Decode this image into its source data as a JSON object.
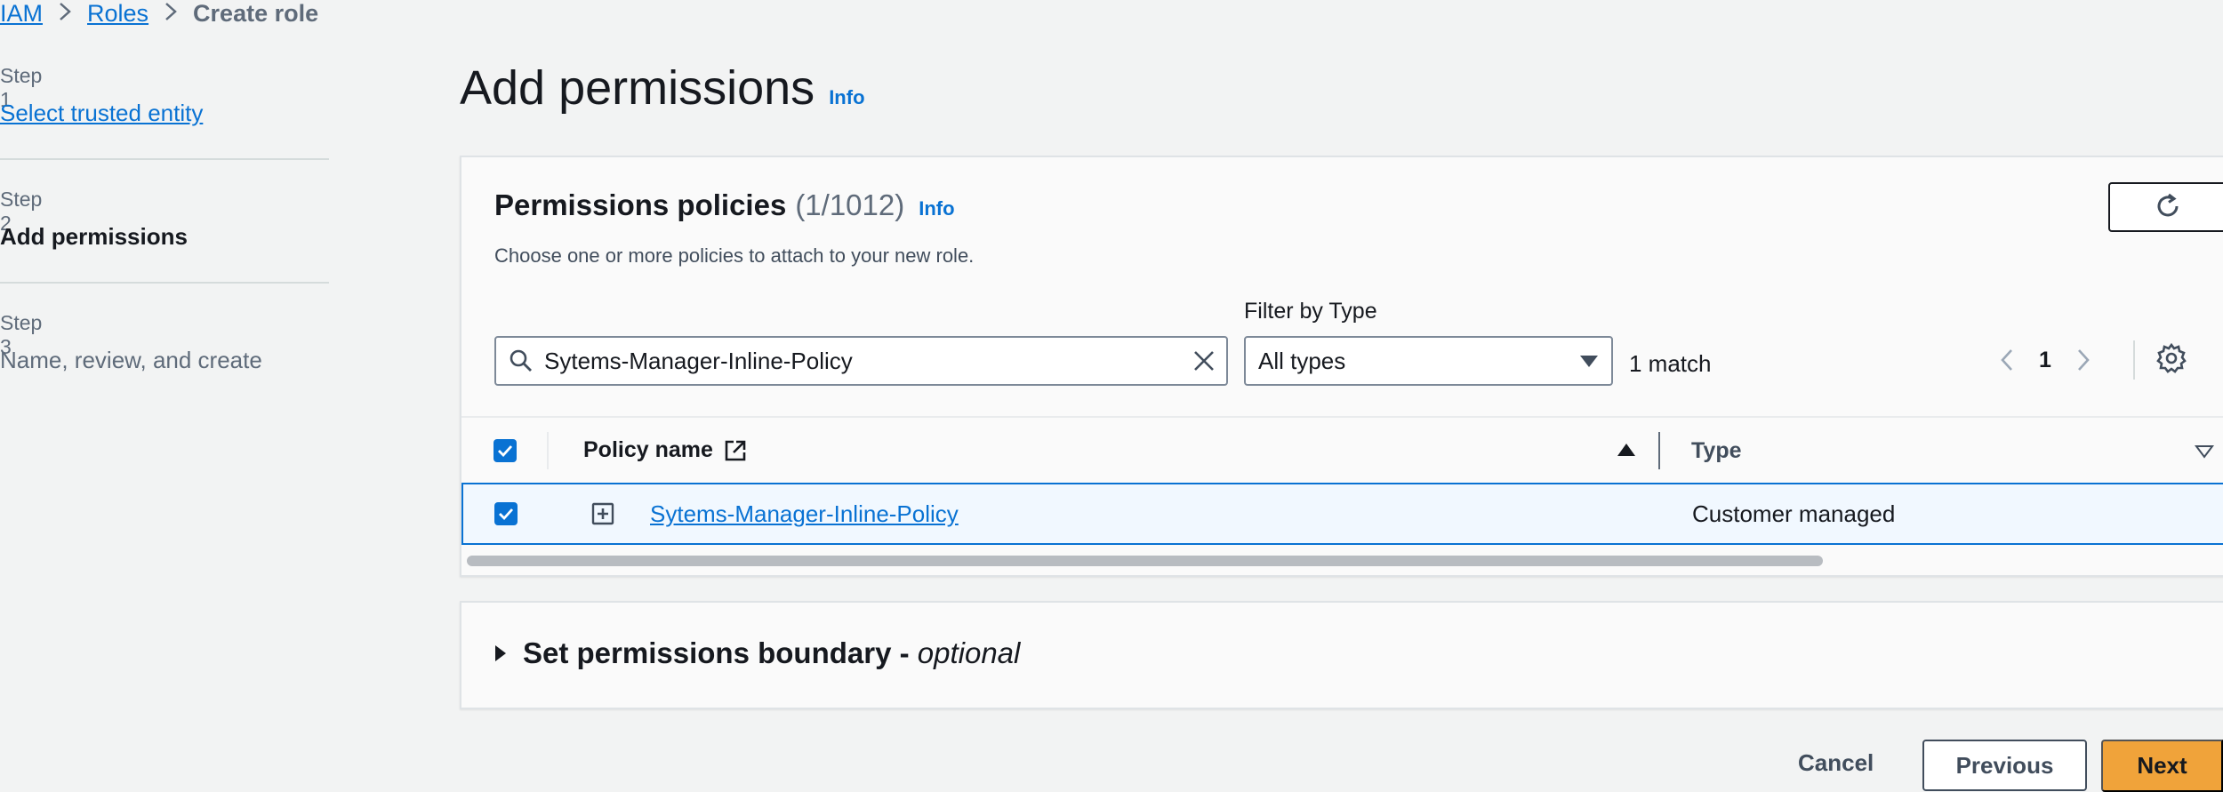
{
  "breadcrumb": {
    "items": [
      "IAM",
      "Roles"
    ],
    "current": "Create role"
  },
  "steps": [
    {
      "label": "Step 1",
      "title": "Select trusted entity",
      "state": "link"
    },
    {
      "label": "Step 2",
      "title": "Add permissions",
      "state": "current"
    },
    {
      "label": "Step 3",
      "title": "Name, review, and create",
      "state": "disabled"
    }
  ],
  "page": {
    "title": "Add permissions",
    "info": "Info"
  },
  "policies": {
    "title": "Permissions policies",
    "count": "(1/1012)",
    "info": "Info",
    "description": "Choose one or more policies to attach to your new role.",
    "search_value": "Sytems-Manager-Inline-Policy",
    "filter_label": "Filter by Type",
    "filter_value": "All types",
    "match_count": "1 match",
    "page_number": "1",
    "columns": {
      "policy_name": "Policy name",
      "type": "Type"
    },
    "rows": [
      {
        "name": "Sytems-Manager-Inline-Policy",
        "type": "Customer managed",
        "selected": true
      }
    ]
  },
  "boundary": {
    "title": "Set permissions boundary - ",
    "optional": "optional"
  },
  "footer": {
    "cancel": "Cancel",
    "previous": "Previous",
    "next": "Next"
  },
  "colors": {
    "accent": "#0972d3",
    "primary_button": "#f0a33a",
    "background": "#f2f3f3"
  },
  "icons": [
    "search-icon",
    "clear-icon",
    "caret-down-icon",
    "chevron-left-icon",
    "chevron-right-icon",
    "settings-icon",
    "refresh-icon",
    "external-link-icon",
    "sort-ascending-icon",
    "sort-descending-icon",
    "expand-icon",
    "caret-right-icon",
    "checkbox-checked-icon"
  ]
}
